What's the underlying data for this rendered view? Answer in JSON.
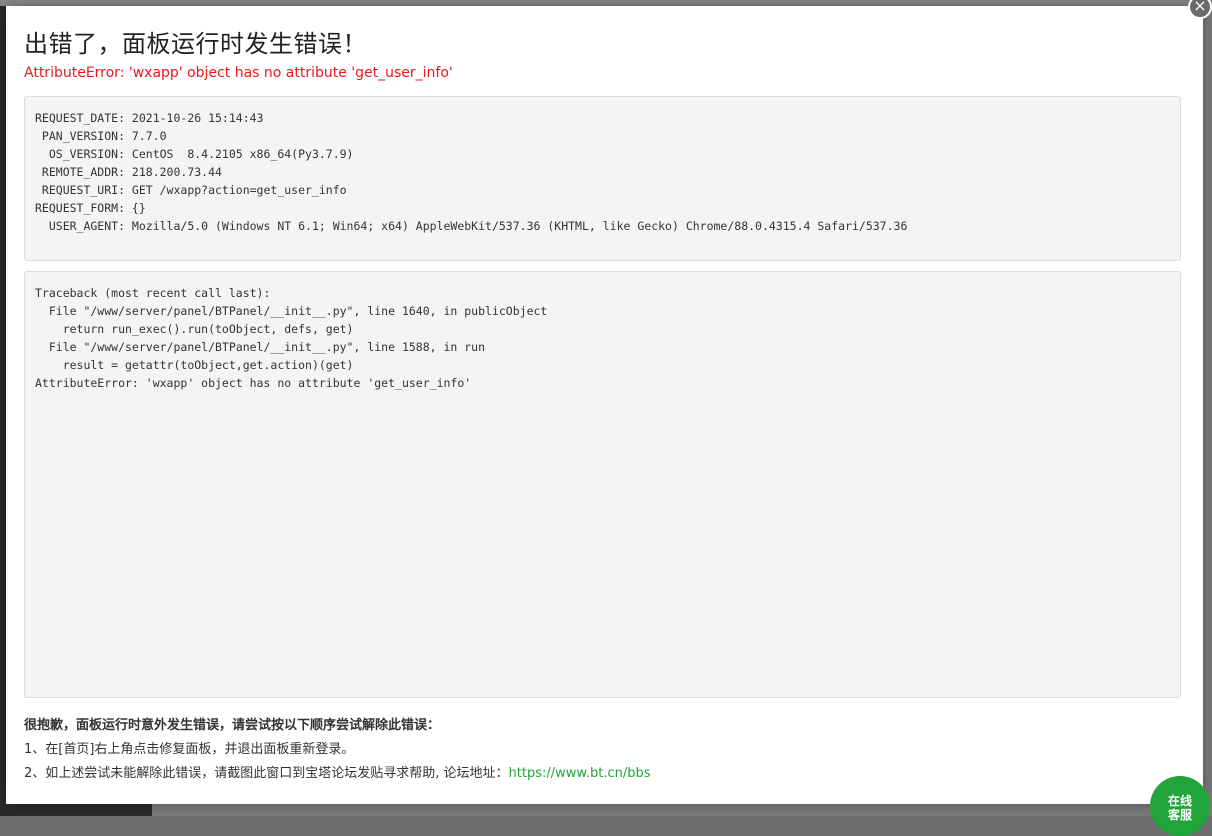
{
  "modal": {
    "title": "出错了，面板运行时发生错误！",
    "subtitle": "AttributeError: 'wxapp' object has no attribute 'get_user_info'",
    "close_icon": "×"
  },
  "request_info": [
    "REQUEST_DATE: 2021-10-26 15:14:43",
    " PAN_VERSION: 7.7.0",
    "  OS_VERSION: CentOS  8.4.2105 x86_64(Py3.7.9)",
    " REMOTE_ADDR: 218.200.73.44",
    " REQUEST_URI: GET /wxapp?action=get_user_info",
    "REQUEST_FORM: {}",
    "  USER_AGENT: Mozilla/5.0 (Windows NT 6.1; Win64; x64) AppleWebKit/537.36 (KHTML, like Gecko) Chrome/88.0.4315.4 Safari/537.36"
  ],
  "traceback": [
    "Traceback (most recent call last):",
    "  File \"/www/server/panel/BTPanel/__init__.py\", line 1640, in publicObject",
    "    return run_exec().run(toObject, defs, get)",
    "  File \"/www/server/panel/BTPanel/__init__.py\", line 1588, in run",
    "    result = getattr(toObject,get.action)(get)",
    "AttributeError: 'wxapp' object has no attribute 'get_user_info'"
  ],
  "help": {
    "heading": "很抱歉，面板运行时意外发生错误，请尝试按以下顺序尝试解除此错误：",
    "step1": "1、在[首页]右上角点击修复面板，并退出面板重新登录。",
    "step2_text": "2、如上述尝试未能解除此错误，请截图此窗口到宝塔论坛发贴寻求帮助, 论坛地址：",
    "forum_link": "https://www.bt.cn/bbs"
  },
  "chat_button": {
    "line1": "在线",
    "line2": "客服"
  },
  "colors": {
    "error_red": "#e8191b",
    "link_green": "#20a53a"
  }
}
